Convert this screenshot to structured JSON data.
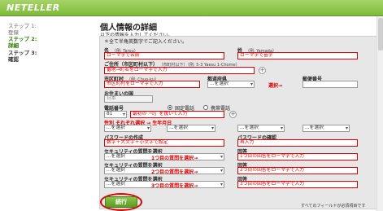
{
  "header": {
    "logo": "NETELLER"
  },
  "sidebar": {
    "steps": [
      {
        "num": "ステップ 1:",
        "label": "登録"
      },
      {
        "num": "ステップ 2:",
        "label": "詳細"
      },
      {
        "num": "ステップ 3:",
        "label": "確認"
      }
    ]
  },
  "page": {
    "title": "個人情報の詳細",
    "subtitle": "以下の情報を入力してください。",
    "note": "＊全て半角英数字でご記入ください。",
    "required_note": "すべてのフィールドが必須項目です",
    "continue_label": "続行"
  },
  "form": {
    "first_name": {
      "label": "名",
      "hint": "（例: Tarou）",
      "value": "ローマ字で名前"
    },
    "last_name": {
      "label": "姓",
      "hint": "（例: Yamada）",
      "value": "ローマ字で苗字"
    },
    "address": {
      "label": "ご住所（市区町村以下）",
      "hint": "（市町村以下）（例: 5-3 Yaesu 1-Chome）",
      "value": "番地→町名をローマ字で入力"
    },
    "city": {
      "label": "市区町村",
      "hint": "（例: Chuo-ku）",
      "value": "市区町村をローマ字で入力"
    },
    "prefecture": {
      "label": "都道府県",
      "value": "...を選択",
      "arrow": "選択→"
    },
    "postal": {
      "label": "郵便番号",
      "value": ""
    },
    "country": {
      "label": "お住まいの国",
      "value": "日本"
    },
    "phone": {
      "label": "電話番号",
      "code": "81",
      "value": "最初の「0」を抜いて入力",
      "opt_fixed": "固定電話",
      "opt_mobile": "携帯電話"
    },
    "gender_dob": {
      "label": "性別 それぞれ選択 → 生年月日",
      "gender": "...を選択",
      "dob_y": "...を選択",
      "dob_m": "...を選択",
      "dob_d": "...を選択"
    },
    "password": {
      "label": "パスワードの作成",
      "value": "数字＋大文字＋小文字で設定"
    },
    "password_confirm": {
      "label": "パスワードの確認",
      "value": "再入力"
    },
    "sq1": {
      "label": "セキュリティの質問を選択",
      "value": "...を選択",
      "arrow": "1つ目の質問を選択→"
    },
    "sa1": {
      "label": "回答",
      "value": "1つ目の回答をローマ字で入力"
    },
    "sq2": {
      "label": "セキュリティの質問を選択",
      "value": "...を選択",
      "arrow": "2つ目の質問を選択→"
    },
    "sa2": {
      "label": "回答",
      "value": "2つ目の回答をローマ字で入力"
    },
    "sq3": {
      "label": "セキュリティの質問を選択",
      "value": "...を選択",
      "arrow": "3つ目の質問を選択→"
    },
    "sa3": {
      "label": "回答",
      "value": "3つ目の回答をローマ字で入力"
    }
  }
}
